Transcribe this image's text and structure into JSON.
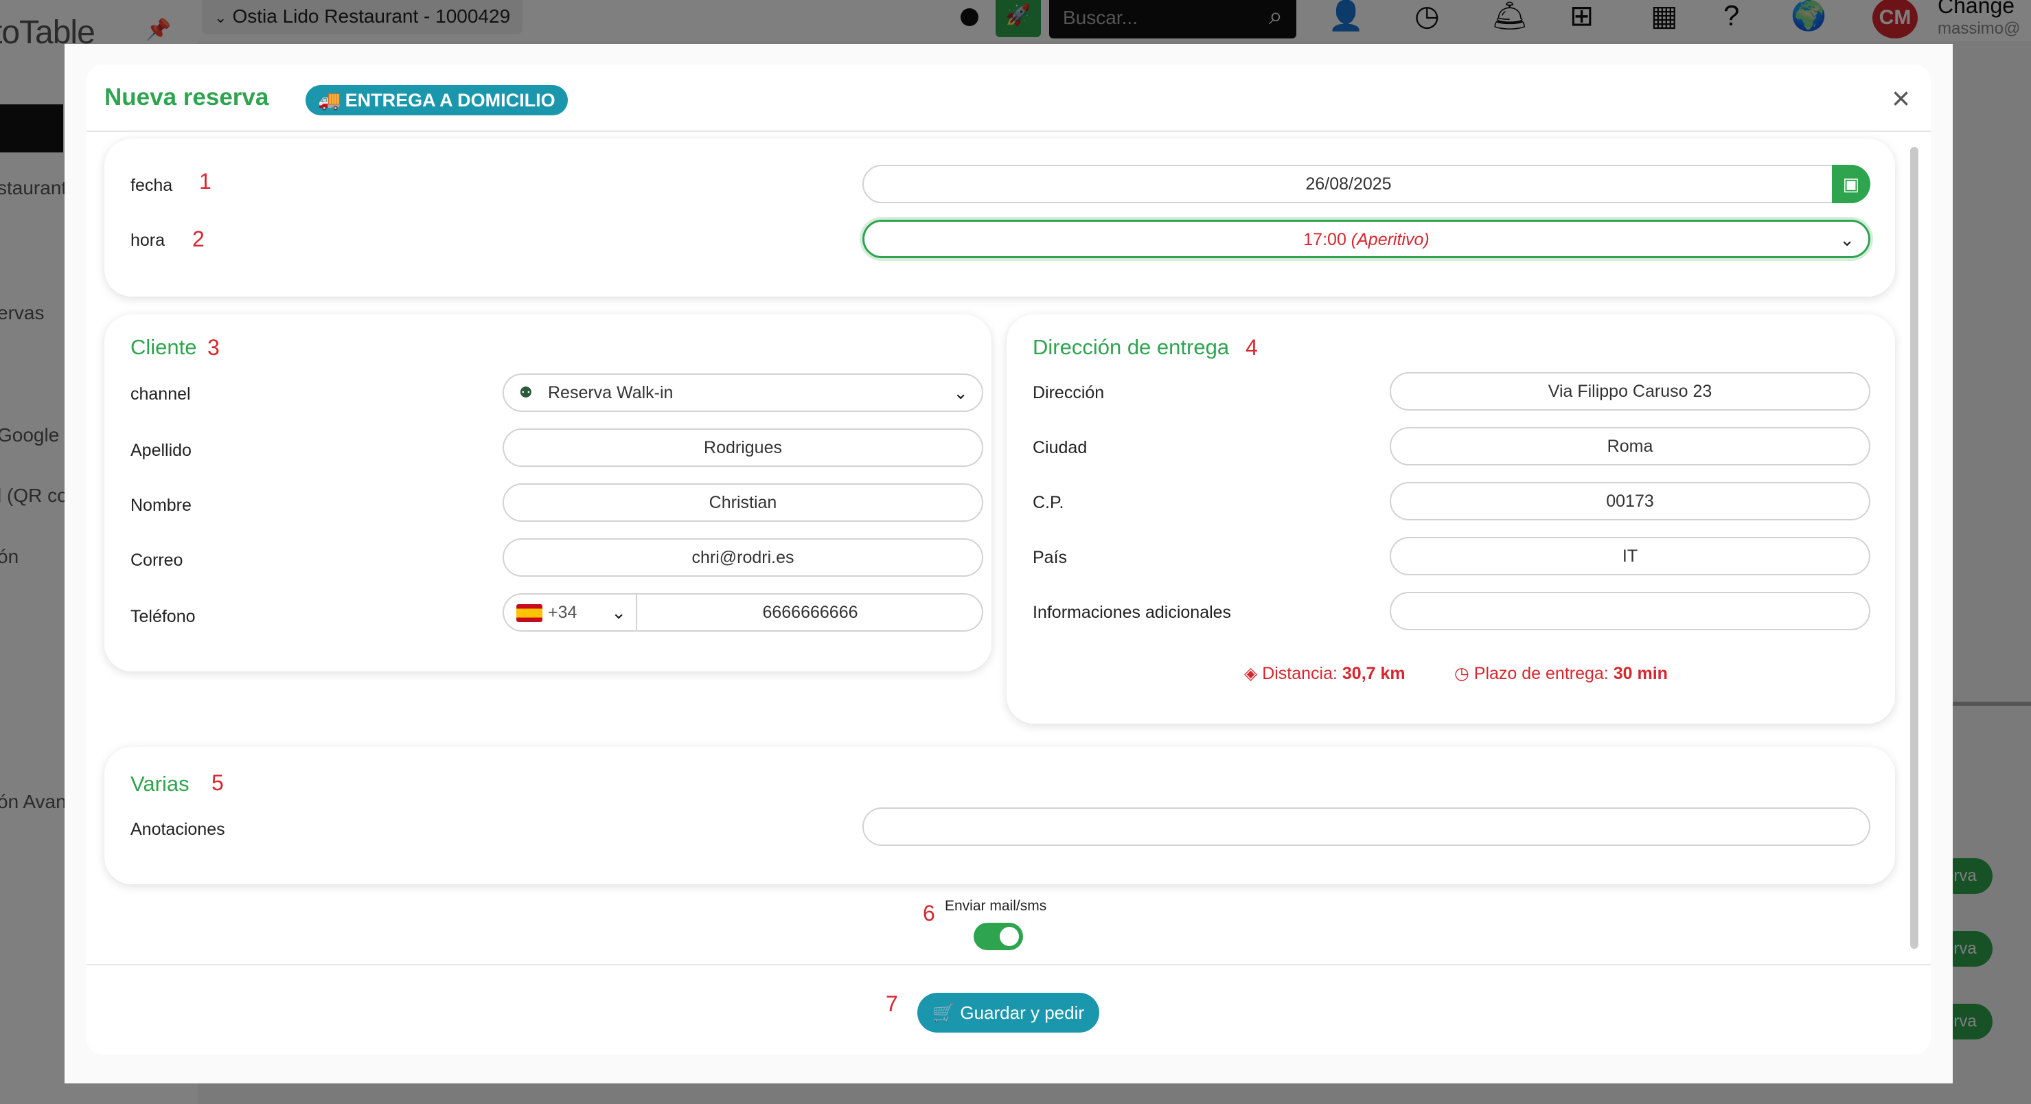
{
  "background": {
    "logo": "toTable",
    "restaurant": "Ostia Lido Restaurant - 1000429",
    "search_placeholder": "Buscar...",
    "avatar": "CM",
    "user_title": "Change",
    "user_sub": "massimo@",
    "sidebar": [
      "staurant",
      "ervas",
      "Google",
      "l (QR co",
      "ón",
      "ón Avan"
    ],
    "right_buttons": [
      "erva",
      "erva",
      "erva"
    ]
  },
  "modal": {
    "title": "Nueva reserva",
    "badge": "ENTREGA A DOMICILIO",
    "fecha_label": "fecha",
    "fecha_value": "26/08/2025",
    "hora_label": "hora",
    "hora_time": "17:00",
    "hora_note": "(Aperitivo)",
    "cliente": {
      "title": "Cliente",
      "channel_label": "channel",
      "channel_value": "Reserva Walk-in",
      "apellido_label": "Apellido",
      "apellido_value": "Rodrigues",
      "nombre_label": "Nombre",
      "nombre_value": "Christian",
      "correo_label": "Correo",
      "correo_value": "chri@rodri.es",
      "telefono_label": "Teléfono",
      "phone_prefix": "+34",
      "phone_value": "6666666666"
    },
    "direccion": {
      "title": "Dirección de entrega",
      "direccion_label": "Dirección",
      "direccion_value": "Via Filippo Caruso 23",
      "ciudad_label": "Ciudad",
      "ciudad_value": "Roma",
      "cp_label": "C.P.",
      "cp_value": "00173",
      "pais_label": "País",
      "pais_value": "IT",
      "info_label": "Informaciones adicionales",
      "info_value": "",
      "distancia_label": "Distancia:",
      "distancia_value": "30,7 km",
      "plazo_label": "Plazo de entrega:",
      "plazo_value": "30 min"
    },
    "varias": {
      "title": "Varias",
      "anotaciones_label": "Anotaciones",
      "anotaciones_value": ""
    },
    "notify_label": "Enviar mail/sms",
    "notify_on": true,
    "save_label": "Guardar y pedir"
  },
  "step_numbers": [
    "1",
    "2",
    "3",
    "4",
    "5",
    "6",
    "7"
  ],
  "colors": {
    "green": "#2ea44f",
    "teal": "#1a96ad",
    "red": "#d8262e"
  }
}
